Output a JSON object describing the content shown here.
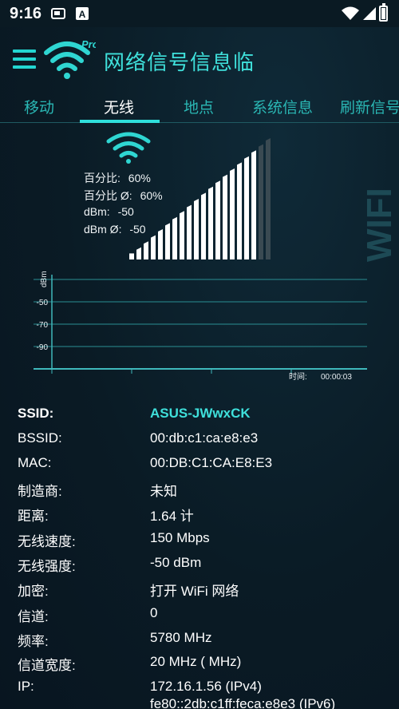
{
  "status_bar": {
    "time": "9:16",
    "icons": [
      "image-icon",
      "a-icon",
      "wifi-icon",
      "signal-icon",
      "battery-icon"
    ]
  },
  "app": {
    "title": "网络信号信息临",
    "logo_badge": "Pro"
  },
  "tabs": [
    {
      "label": "移动",
      "active": false
    },
    {
      "label": "无线",
      "active": true
    },
    {
      "label": "地点",
      "active": false
    },
    {
      "label": "系统信息",
      "active": false
    },
    {
      "label": "刷新信号",
      "active": false
    }
  ],
  "signal": {
    "percent_label": "百分比:",
    "percent_value": "60%",
    "percent_avg_label": "百分比 Ø:",
    "percent_avg_value": "60%",
    "dbm_label": "dBm:",
    "dbm_value": "-50",
    "dbm_avg_label": "dBm Ø:",
    "dbm_avg_value": "-50",
    "level": 0.6,
    "watermark": "WIFI"
  },
  "graph": {
    "ylabel": "dBm",
    "ticks": [
      "-50",
      "-70",
      "-90"
    ],
    "time_label": "时间:",
    "time_value": "00:00:03"
  },
  "info": [
    {
      "label": "SSID:",
      "value": "ASUS-JWwxCK"
    },
    {
      "label": "BSSID:",
      "value": "00:db:c1:ca:e8:e3"
    },
    {
      "label": "MAC:",
      "value": "00:DB:C1:CA:E8:E3"
    },
    {
      "label": "制造商:",
      "value": "未知"
    },
    {
      "label": "距离:",
      "value": "1.64 计"
    },
    {
      "label": "无线速度:",
      "value": "150 Mbps"
    },
    {
      "label": "无线强度:",
      "value": "-50 dBm"
    },
    {
      "label": "加密:",
      "value": "打开 WiFi 网络"
    },
    {
      "label": "信道:",
      "value": "0"
    },
    {
      "label": "频率:",
      "value": "5780 MHz"
    },
    {
      "label": "信道宽度:",
      "value": "20 MHz ( MHz)"
    },
    {
      "label": "IP:",
      "value": "172.16.1.56 (IPv4)",
      "value2": "fe80::2db:c1ff:feca:e8e3 (IPv6)"
    }
  ],
  "colors": {
    "accent": "#3fe0db",
    "tab_inactive": "#2ab7b4",
    "background": "#0a1b25"
  }
}
